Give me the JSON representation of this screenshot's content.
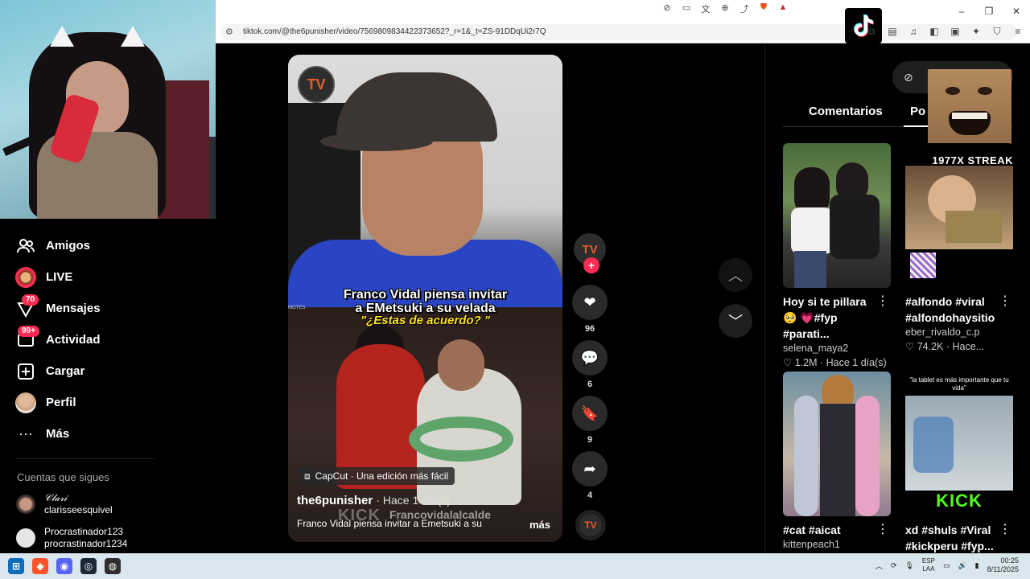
{
  "browser": {
    "url": "tiktok.com/@the6punisher/video/7569809834422373652?_r=1&_t=ZS-91DDqUi2r7Q"
  },
  "sidebar": {
    "items": [
      {
        "label": "Amigos",
        "icon": "friends-icon"
      },
      {
        "label": "LIVE",
        "icon": "live-avatar"
      },
      {
        "label": "Mensajes",
        "icon": "messages-icon",
        "badge": "70"
      },
      {
        "label": "Actividad",
        "icon": "activity-icon",
        "badge": "99+"
      },
      {
        "label": "Cargar",
        "icon": "upload-icon"
      },
      {
        "label": "Perfil",
        "icon": "profile-avatar"
      },
      {
        "label": "Más",
        "icon": "more-icon"
      }
    ],
    "follows_title": "Cuentas que sigues",
    "follows": [
      {
        "name": "𝒞𝓁𝒶𝓇𝒾",
        "username": "clarisseesquivel"
      },
      {
        "name": "Procrastinador123",
        "username": "procrastinador1234"
      }
    ]
  },
  "video": {
    "caption_line1": "Franco Vidal piensa invitar",
    "caption_line2": "a EMetsuki a su velada",
    "caption_question": "\"¿Estas de acuerdo? \"",
    "motes": "MOTES",
    "capcut": "CapCut · Una edición más fácil",
    "author": "the6punisher",
    "when": "· Hace 1 día(s)",
    "kick_watermark": "KICK",
    "kick_user": "Francovidalalcalde",
    "description": "Franco Vidal piensa invitar a Emetsuki a su",
    "more": "más",
    "likes": "96",
    "comments": "6",
    "saves": "9",
    "shares": "4",
    "avatar_mark": "TV"
  },
  "right_panel": {
    "tabs": [
      "Comentarios",
      "Po"
    ],
    "meme_overlay": "1977X STREAK",
    "cards": [
      {
        "title": "Hoy si te pillara 🥺 💗#fyp #parati...",
        "user": "selena_maya2",
        "likes": "1.2M",
        "when": "Hace 1 día(s)"
      },
      {
        "title": "#alfondo #viral #alfondohaysitio",
        "user": "eber_rivaldo_c.p",
        "likes": "74.2K",
        "when": "Hace..."
      },
      {
        "title": "#cat #aicat",
        "user": "kittenpeach1",
        "likes": "",
        "when": ""
      },
      {
        "title": "xd #shuls #Viral #kickperu #fyp...",
        "user": "",
        "likes": "",
        "when": "",
        "overlay_top": "\"la tablet es más importante que tu vida\"",
        "overlay_kick": "KICK"
      }
    ]
  },
  "taskbar": {
    "lang1": "ESP",
    "lang2": "LAA",
    "time": "00:25",
    "date": "8/11/2025"
  },
  "colors": {
    "accent": "#fe2c55",
    "background": "#000000",
    "taskbar": "#d9e6ee"
  }
}
